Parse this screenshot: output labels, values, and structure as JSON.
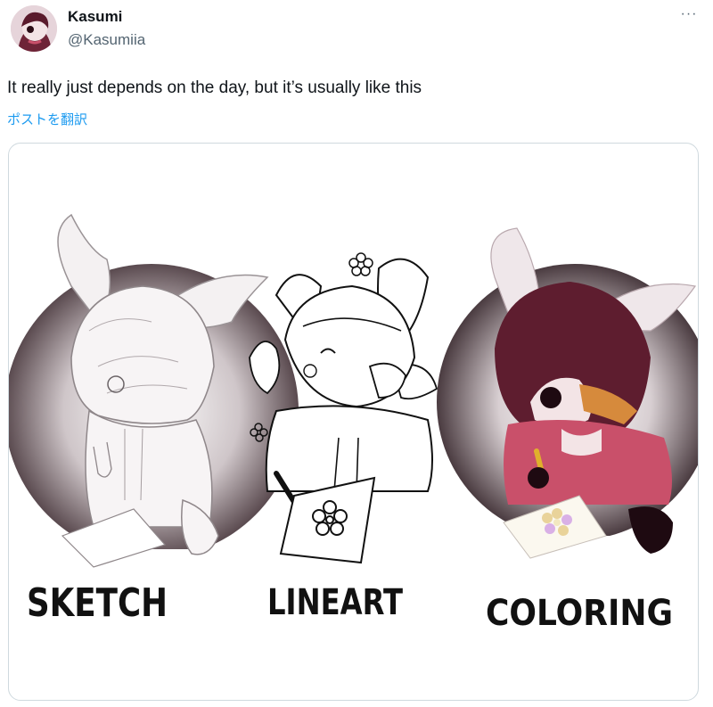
{
  "author": {
    "display_name": "Kasumi",
    "handle": "@Kasumiia",
    "avatar_icon": "avatar-portrait"
  },
  "menu": {
    "more_label": "···",
    "icon": "more-dots-icon"
  },
  "post": {
    "text": "It really just depends on the day, but it’s usually like this",
    "translate_label": "ポストを翻訳"
  },
  "media": {
    "captions": {
      "sketch": "SKETCH",
      "lineart": "LINEART",
      "coloring": "COLORING"
    }
  },
  "colors": {
    "text_primary": "#0f1419",
    "text_secondary": "#536471",
    "link": "#1d9bf0",
    "card_border": "#cfd9de",
    "coloring_hair": "#5e1d2f",
    "coloring_sweater": "#c9506a"
  }
}
